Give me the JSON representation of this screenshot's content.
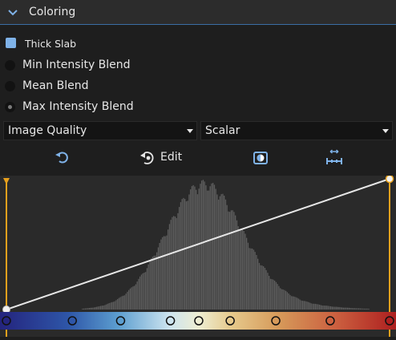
{
  "section": {
    "title": "Coloring",
    "icon": "chevron-down-icon"
  },
  "thick_slab": {
    "label": "Thick Slab",
    "checked": true
  },
  "blend_modes": [
    {
      "label": "Min Intensity Blend",
      "checked": false
    },
    {
      "label": "Mean Blend",
      "checked": false
    },
    {
      "label": "Max Intensity Blend",
      "checked": true
    }
  ],
  "presets_select": {
    "value": "Image Quality"
  },
  "scalar_select": {
    "value": "Scalar"
  },
  "toolbar": {
    "reset_icon": "reset-icon",
    "edit_label": "Edit",
    "edit_icon": "edit-rotate-icon",
    "invert_icon": "invert-icon",
    "range_icon": "range-icon"
  },
  "colors": {
    "accent": "#3b6ea5",
    "checkbox": "#7fb2e8",
    "handle": "#e8a11d",
    "histogram": "#5e5e5e",
    "opacity_line": "#e6e6e6"
  },
  "transfer_function": {
    "opacity_points": [
      {
        "x": 0.0,
        "y": 0.0
      },
      {
        "x": 1.0,
        "y": 1.0
      }
    ],
    "color_stops": [
      {
        "pos": 0.0,
        "color": "#24247e"
      },
      {
        "pos": 0.172,
        "color": "#2e56a8"
      },
      {
        "pos": 0.298,
        "color": "#5c9ed0"
      },
      {
        "pos": 0.428,
        "color": "#cde4ef"
      },
      {
        "pos": 0.502,
        "color": "#eeeed2"
      },
      {
        "pos": 0.584,
        "color": "#e6c98c"
      },
      {
        "pos": 0.703,
        "color": "#d69a5a"
      },
      {
        "pos": 0.845,
        "color": "#cc6140"
      },
      {
        "pos": 1.0,
        "color": "#ad1f1f"
      }
    ]
  }
}
